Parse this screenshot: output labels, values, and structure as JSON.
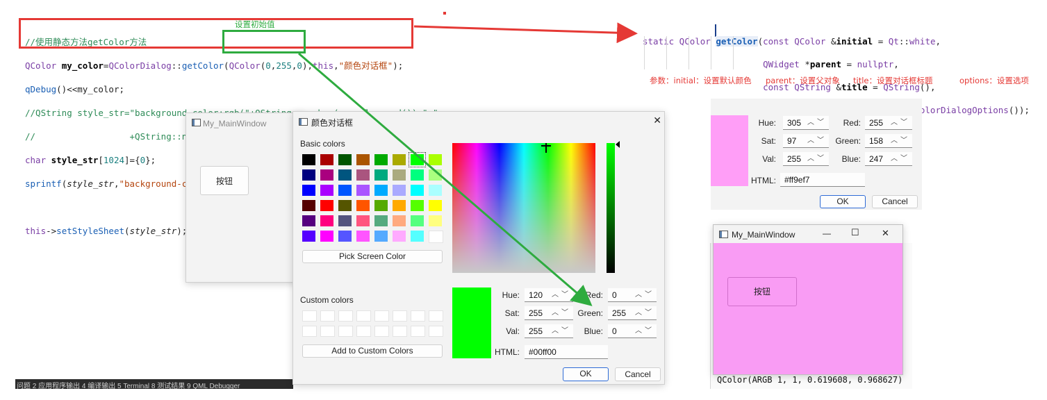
{
  "code": {
    "lines": [
      "//使用静态方法getColor方法",
      "QColor my_color=QColorDialog::getColor(QColor(0,255,0),this,\"颜色对话框\");",
      "qDebug()<<my_color;",
      "//QString style_str=\"background-color:rgb(\"+QString::number(my_color.red())+\",\"",
      "//                  +QString::number(my_color.green())+\",\"+QString::number(my_color.blue())+\")\";",
      "char style_str[1024]={0};",
      "sprintf(style_str,\"background-color:rgb(%d,%d,%d)\",my_color.red(),my_color.green(),my_color.blue());",
      "",
      "this->setStyleSheet(style_str);"
    ]
  },
  "annotation_initial": "设置初始值",
  "signature": {
    "lines": [
      "static QColor getColor(const QColor &initial = Qt::white,",
      "                       QWidget *parent = nullptr,",
      "                       const QString &title = QString(),",
      "                       ColorDialogOptions options = ColorDialogOptions());"
    ],
    "notes": [
      "参数：initial：设置默认颜色",
      "parent：设置父对象",
      "title：设置对话框标题",
      "options：设置选项"
    ]
  },
  "bg_window": {
    "title": "My_MainWindow",
    "button_label": "按钮"
  },
  "dialog": {
    "title": "颜色对话框",
    "close_glyph": "✕",
    "basic_colors_label": "Basic colors",
    "custom_colors_label": "Custom colors",
    "pick_screen_label": "Pick Screen Color",
    "add_custom_label": "Add to Custom Colors",
    "basic_colors": [
      [
        "#000000",
        "#aa0000",
        "#005500",
        "#aa5500",
        "#00aa00",
        "#aaaa00",
        "#00ff00",
        "#aaff00"
      ],
      [
        "#00007f",
        "#aa007f",
        "#00557f",
        "#aa557f",
        "#00aa7f",
        "#aaaa7f",
        "#00ff7f",
        "#aaff7f"
      ],
      [
        "#0000ff",
        "#aa00ff",
        "#0055ff",
        "#aa55ff",
        "#00aaff",
        "#aaaaff",
        "#00ffff",
        "#aaffff"
      ],
      [
        "#550000",
        "#ff0000",
        "#555500",
        "#ff5500",
        "#55aa00",
        "#ffaa00",
        "#55ff00",
        "#ffff00"
      ],
      [
        "#55007f",
        "#ff007f",
        "#55557f",
        "#ff557f",
        "#55aa7f",
        "#ffaa7f",
        "#55ff7f",
        "#ffff7f"
      ],
      [
        "#5500ff",
        "#ff00ff",
        "#5555ff",
        "#ff55ff",
        "#55aaff",
        "#ffaaff",
        "#55ffff",
        "#ffffff"
      ]
    ],
    "selected_swatch": "#00ff00",
    "hue_label": "Hue:",
    "hue": "120",
    "sat_label": "Sat:",
    "sat": "255",
    "val_label": "Val:",
    "val": "255",
    "red_label": "Red:",
    "red": "0",
    "green_label": "Green:",
    "green": "255",
    "blue_label": "Blue:",
    "blue": "0",
    "html_label": "HTML:",
    "html": "#00ff00",
    "ok_label": "OK",
    "cancel_label": "Cancel"
  },
  "result_panel": {
    "preview_color": "#ff9ef7",
    "hue_label": "Hue:",
    "hue": "305",
    "sat_label": "Sat:",
    "sat": "97",
    "val_label": "Val:",
    "val": "255",
    "red_label": "Red:",
    "red": "255",
    "green_label": "Green:",
    "green": "158",
    "blue_label": "Blue:",
    "blue": "247",
    "html_label": "HTML:",
    "html": "#ff9ef7",
    "ok_label": "OK",
    "cancel_label": "Cancel"
  },
  "result_window": {
    "title": "My_MainWindow",
    "button_label": "按钮",
    "bg_color": "#f99cf4",
    "minimize_glyph": "—",
    "maximize_glyph": "☐",
    "close_glyph": "✕"
  },
  "debug_output": "QColor(ARGB 1, 1, 0.619608, 0.968627)",
  "bottom_bar_text": "问题  2 应用程序输出  4 编译输出  5 Terminal  8 测试结果  9 QML Debugger"
}
